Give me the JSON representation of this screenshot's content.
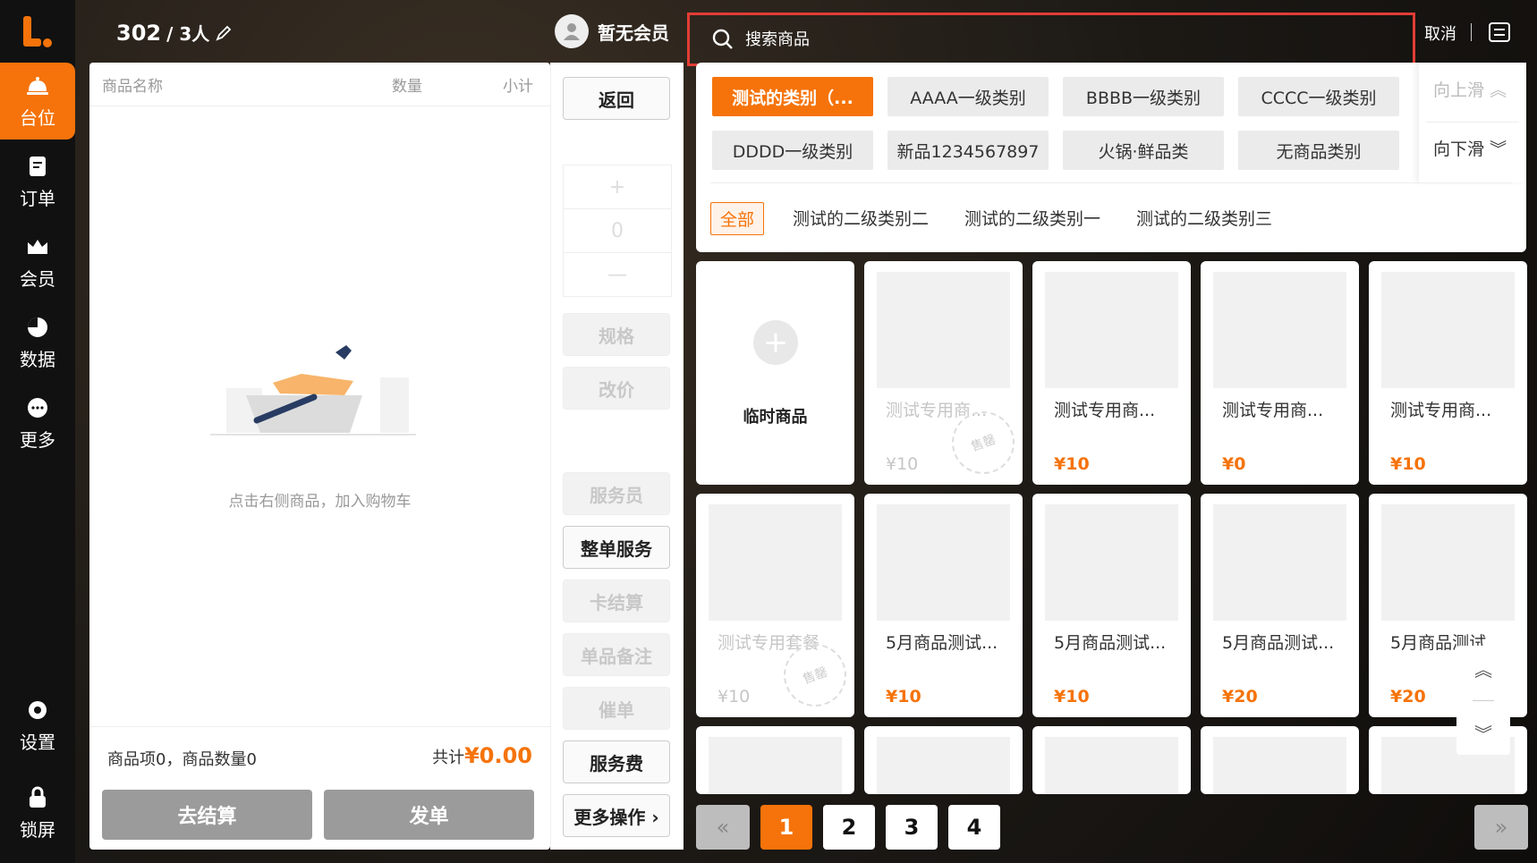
{
  "nav": {
    "items": [
      {
        "label": "台位",
        "icon": "bell-icon"
      },
      {
        "label": "订单",
        "icon": "order-icon"
      },
      {
        "label": "会员",
        "icon": "crown-icon"
      },
      {
        "label": "数据",
        "icon": "pie-chart-icon"
      },
      {
        "label": "更多",
        "icon": "more-icon"
      },
      {
        "label": "设置",
        "icon": "gear-icon"
      },
      {
        "label": "锁屏",
        "icon": "lock-icon"
      }
    ]
  },
  "header": {
    "table_no": "302",
    "people": "/ 3人",
    "member": "暂无会员",
    "search_placeholder": "搜索商品",
    "cancel": "取消"
  },
  "cart": {
    "col_name": "商品名称",
    "col_qty": "数量",
    "col_subtotal": "小计",
    "empty_text": "点击右侧商品，加入购物车",
    "summary": "商品项0，商品数量0",
    "total_label": "共计",
    "total_value": "¥0.00",
    "checkout": "去结算",
    "send": "发单"
  },
  "actions": {
    "back": "返回",
    "plus": "+",
    "qty": "0",
    "minus": "—",
    "spec": "规格",
    "change_price": "改价",
    "waiter": "服务员",
    "whole_service": "整单服务",
    "card_settle": "卡结算",
    "item_note": "单品备注",
    "urge": "催单",
    "service_fee": "服务费",
    "more_ops": "更多操作 ›"
  },
  "categories": {
    "row1": [
      "测试的类别（...",
      "AAAA一级类别",
      "BBBB一级类别",
      "CCCC一级类别"
    ],
    "row2": [
      "DDDD一级类别",
      "新品1234567897",
      "火锅·鲜品类",
      "无商品类别"
    ],
    "scroll_up": "向上滑",
    "scroll_down": "向下滑",
    "sub": [
      "全部",
      "测试的二级类别二",
      "测试的二级类别一",
      "测试的二级类别三"
    ]
  },
  "products": {
    "temp_label": "临时商品",
    "sold_stamp": "售罄",
    "row1": [
      {
        "name": "测试专用商...",
        "price": "¥10",
        "sold_out": true
      },
      {
        "name": "测试专用商...",
        "price": "¥10",
        "sold_out": false
      },
      {
        "name": "测试专用商...",
        "price": "¥0",
        "sold_out": false
      },
      {
        "name": "测试专用商...",
        "price": "¥10",
        "sold_out": false
      }
    ],
    "row2": [
      {
        "name": "测试专用套餐",
        "price": "¥10",
        "sold_out": true
      },
      {
        "name": "5月商品测试...",
        "price": "¥10",
        "sold_out": false
      },
      {
        "name": "5月商品测试...",
        "price": "¥10",
        "sold_out": false
      },
      {
        "name": "5月商品测试...",
        "price": "¥20",
        "sold_out": false
      },
      {
        "name": "5月商品测试...",
        "price": "¥20",
        "sold_out": false
      }
    ]
  },
  "pagination": {
    "pages": [
      "1",
      "2",
      "3",
      "4"
    ],
    "current": "1",
    "prev": "«",
    "next": "»"
  },
  "colors": {
    "accent": "#f5730a",
    "search_border": "#e23d35"
  }
}
